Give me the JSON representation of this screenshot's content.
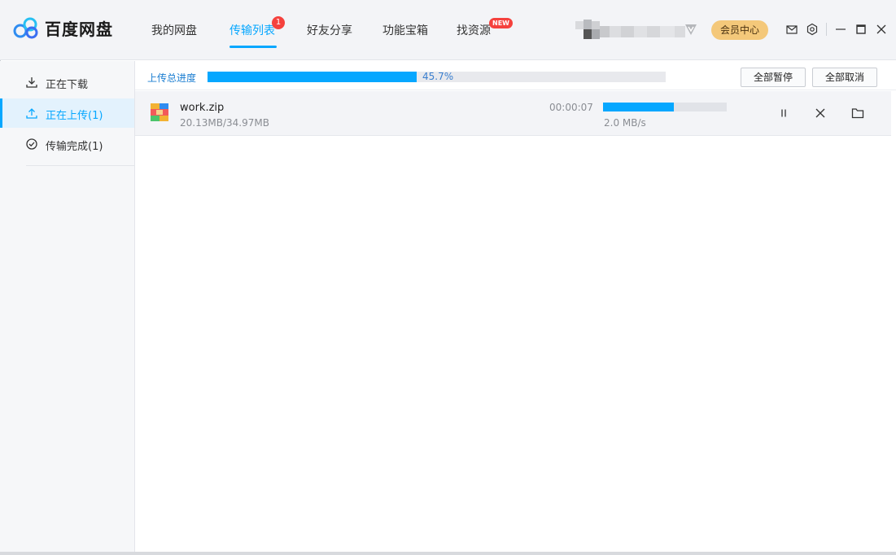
{
  "app": {
    "brand": "百度网盘"
  },
  "nav": {
    "items": [
      {
        "label": "我的网盘"
      },
      {
        "label": "传输列表",
        "active": true,
        "badge": "1"
      },
      {
        "label": "好友分享"
      },
      {
        "label": "功能宝箱"
      },
      {
        "label": "找资源",
        "badge": "NEW"
      }
    ]
  },
  "header": {
    "vip_label": "会员中心",
    "icons": [
      "mail-icon",
      "settings-icon",
      "minimize-icon",
      "maximize-icon",
      "close-icon"
    ]
  },
  "sidebar": {
    "items": [
      {
        "label": "正在下载",
        "icon": "download-icon"
      },
      {
        "label": "正在上传(1)",
        "icon": "upload-icon",
        "active": true
      },
      {
        "label": "传输完成(1)",
        "icon": "check-circle-icon"
      }
    ]
  },
  "summary": {
    "label": "上传总进度",
    "percent_text": "45.7%",
    "progress": 0.457,
    "pause_all": "全部暂停",
    "cancel_all": "全部取消"
  },
  "transfers": [
    {
      "name": "work.zip",
      "size_text": "20.13MB/34.97MB",
      "time_left": "00:00:07",
      "speed": "2.0 MB/s",
      "progress": 0.5756,
      "icon": "zip-file-icon"
    }
  ],
  "colors": {
    "accent": "#06a7ff",
    "badge": "#f5413d",
    "vip": "#f4c87a"
  }
}
